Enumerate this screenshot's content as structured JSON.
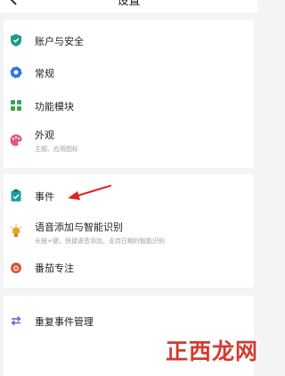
{
  "header": {
    "title": "设置",
    "back_icon": "chevron-left-icon"
  },
  "groups": [
    {
      "items": [
        {
          "label": "账户与安全",
          "icon": "shield-icon",
          "color": "#1b9a8e"
        },
        {
          "label": "常规",
          "icon": "gear-icon",
          "color": "#2e78d8"
        },
        {
          "label": "功能模块",
          "icon": "grid-icon",
          "color": "#3aa64e"
        },
        {
          "label": "外观",
          "subtitle": "主题、应用图标",
          "icon": "palette-icon",
          "color": "#e0577b"
        }
      ]
    },
    {
      "items": [
        {
          "label": "事件",
          "icon": "clipboard-icon",
          "color": "#1f9aa8"
        },
        {
          "label": "语音添加与智能识别",
          "subtitle": "长按+键，快捷语音添加，支持日期的智能识别",
          "icon": "bulb-icon",
          "color": "#f0a020"
        },
        {
          "label": "番茄专注",
          "icon": "tomato-icon",
          "color": "#e5533a"
        }
      ]
    },
    {
      "items": [
        {
          "label": "重复事件管理",
          "icon": "repeat-icon",
          "color": "#7b5cd6"
        }
      ]
    }
  ],
  "annotation": {
    "arrow_color": "#e02525"
  },
  "watermark": {
    "text": "正西龙网"
  }
}
